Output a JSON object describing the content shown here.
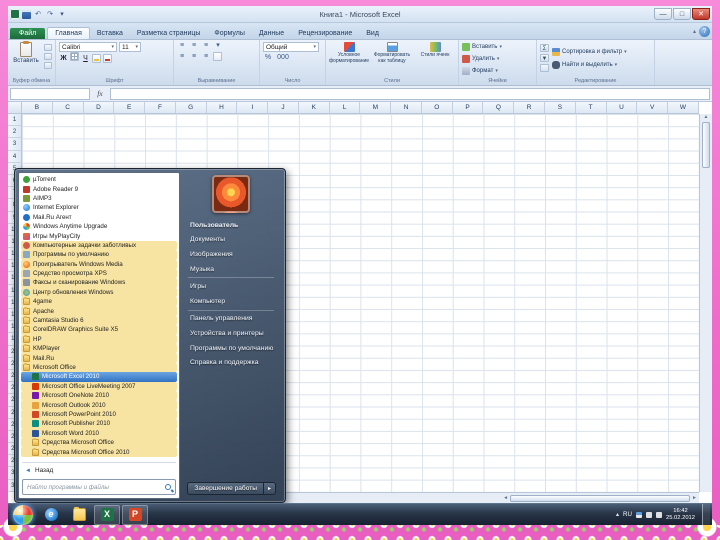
{
  "excel": {
    "title": "Книга1 - Microsoft Excel",
    "qat": {
      "undo": "↶",
      "redo": "↷",
      "caret": "▾"
    },
    "window_buttons": {
      "minimize": "—",
      "maximize": "□",
      "close": "✕"
    },
    "glyphs": {
      "caret": "▾",
      "up": "▲",
      "down": "▼",
      "left": "◄",
      "right": "►",
      "fx": "fx",
      "sigma": "Σ",
      "help": "?",
      "lines": "≡",
      "min_ribbon": "▴"
    },
    "tabs": [
      {
        "label": "Файл",
        "file": true
      },
      {
        "label": "Главная",
        "active": true
      },
      {
        "label": "Вставка"
      },
      {
        "label": "Разметка страницы"
      },
      {
        "label": "Формулы"
      },
      {
        "label": "Данные"
      },
      {
        "label": "Рецензирование"
      },
      {
        "label": "Вид"
      }
    ],
    "ribbon": {
      "groups": [
        {
          "label": "Буфер обмена"
        },
        {
          "label": "Шрифт"
        },
        {
          "label": "Выравнивание"
        },
        {
          "label": "Число"
        },
        {
          "label": "Стили"
        },
        {
          "label": "Ячейки"
        },
        {
          "label": "Редактирование"
        }
      ],
      "paste_label": "Вставить",
      "font_name": "Calibri",
      "font_size": "11",
      "bold": "Ж",
      "italic": "К",
      "underline": "Ч",
      "number_format": "Общий",
      "number_icons": [
        "%",
        "000"
      ],
      "styles_buttons": [
        "Условное форматирование",
        "Форматировать как таблицу",
        "Стили ячеек"
      ],
      "cells_buttons": [
        "Вставить",
        "Удалить",
        "Формат"
      ],
      "editing_buttons": [
        "Сортировка и фильтр",
        "Найти и выделить"
      ]
    },
    "formula": {
      "name_box": ""
    },
    "grid": {
      "columns": [
        "B",
        "C",
        "D",
        "E",
        "F",
        "G",
        "H",
        "I",
        "J",
        "K",
        "L",
        "M",
        "N",
        "O",
        "P",
        "Q",
        "R",
        "S",
        "T",
        "U",
        "V",
        "W"
      ],
      "row_count": 31
    }
  },
  "start_menu": {
    "left_items": [
      {
        "label": "µTorrent",
        "icon": "utorrent"
      },
      {
        "label": "Adobe Reader 9",
        "icon": "adobe"
      },
      {
        "label": "AIMP3",
        "icon": "aimp"
      },
      {
        "label": "Internet Explorer",
        "icon": "ie"
      },
      {
        "label": "Mail.Ru Агент",
        "icon": "mailru"
      },
      {
        "label": "Windows Anytime Upgrade",
        "icon": "windows"
      },
      {
        "label": "Игры MyPlayCity",
        "icon": "games"
      },
      {
        "label": "Компьютерные задачки заботливых",
        "icon": "kids",
        "highlight": true
      },
      {
        "label": "Программы по умолчанию",
        "icon": "defaultprog",
        "highlight": true
      },
      {
        "label": "Проигрыватель Windows Media",
        "icon": "wmp",
        "highlight": true
      },
      {
        "label": "Средство просмотра XPS",
        "icon": "xps",
        "highlight": true
      },
      {
        "label": "Факсы и сканирование Windows",
        "icon": "fax",
        "highlight": true
      },
      {
        "label": "Центр обновления Windows",
        "icon": "update",
        "highlight": true
      },
      {
        "label": "4game",
        "icon": "folder",
        "highlight": true
      },
      {
        "label": "Apache",
        "icon": "folder",
        "highlight": true
      },
      {
        "label": "Camtasia Studio 6",
        "icon": "folder",
        "highlight": true
      },
      {
        "label": "CorelDRAW Graphics Suite X5",
        "icon": "folder",
        "highlight": true
      },
      {
        "label": "HP",
        "icon": "folder",
        "highlight": true
      },
      {
        "label": "KMPlayer",
        "icon": "folder",
        "highlight": true
      },
      {
        "label": "Mail.Ru",
        "icon": "folder",
        "highlight": true
      },
      {
        "label": "Microsoft Office",
        "icon": "folder",
        "highlight": true
      },
      {
        "label": "Microsoft Excel 2010",
        "icon": "excel",
        "sub": true,
        "selected": true
      },
      {
        "label": "Microsoft Office LiveMeeting 2007",
        "icon": "office",
        "sub": true,
        "highlight": true
      },
      {
        "label": "Microsoft OneNote 2010",
        "icon": "onenote",
        "sub": true,
        "highlight": true
      },
      {
        "label": "Microsoft Outlook 2010",
        "icon": "outlook",
        "sub": true,
        "highlight": true
      },
      {
        "label": "Microsoft PowerPoint 2010",
        "icon": "powerpoint",
        "sub": true,
        "highlight": true
      },
      {
        "label": "Microsoft Publisher 2010",
        "icon": "publisher",
        "sub": true,
        "highlight": true
      },
      {
        "label": "Microsoft Word 2010",
        "icon": "word",
        "sub": true,
        "highlight": true
      },
      {
        "label": "Средства Microsoft Office",
        "icon": "folder",
        "sub": true,
        "highlight": true
      },
      {
        "label": "Средства Microsoft Office 2010",
        "icon": "folder",
        "sub": true,
        "highlight": true
      }
    ],
    "back": {
      "label": "Назад",
      "arrow": "◄"
    },
    "search_placeholder": "Найти программы и файлы",
    "right_items": [
      {
        "label": "Пользователь",
        "bold": true
      },
      {
        "label": "Документы"
      },
      {
        "label": "Изображения"
      },
      {
        "label": "Музыка",
        "divider_after": true
      },
      {
        "label": "Игры"
      },
      {
        "label": "Компьютер",
        "divider_after": true
      },
      {
        "label": "Панель управления"
      },
      {
        "label": "Устройства и принтеры"
      },
      {
        "label": "Программы по умолчанию"
      },
      {
        "label": "Справка и поддержка"
      }
    ],
    "shutdown": {
      "label": "Завершение работы",
      "arrow": "▸"
    }
  },
  "taskbar": {
    "buttons": [
      {
        "name": "internet-explorer",
        "icon": "ie",
        "glyph": "e"
      },
      {
        "name": "windows-explorer",
        "icon": "explorer",
        "glyph": ""
      },
      {
        "name": "excel",
        "icon": "excel",
        "glyph": "X",
        "active": true
      },
      {
        "name": "powerpoint",
        "icon": "powerpoint",
        "glyph": "P",
        "active": true
      }
    ],
    "tray": {
      "hidden_icons": "▴",
      "lang": "RU",
      "time": "16:42",
      "date": "25.02.2012"
    }
  }
}
